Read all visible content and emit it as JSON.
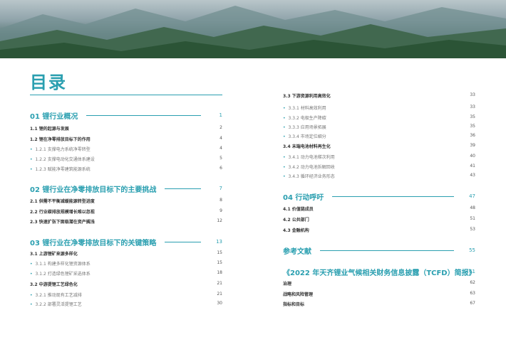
{
  "title": "目录",
  "left": [
    {
      "kind": "sec",
      "label": "01 锂行业概况",
      "page": "1"
    },
    {
      "kind": "sub",
      "label": "1.1 锂的起源与发展",
      "page": "2"
    },
    {
      "kind": "sub",
      "label": "1.2 锂在净零排放目标下的作用",
      "page": "4"
    },
    {
      "kind": "item",
      "label": "1.2.1 支撑电力系统净零转型",
      "page": "4"
    },
    {
      "kind": "item",
      "label": "1.2.2 支撑电动化交通体系建设",
      "page": "5"
    },
    {
      "kind": "item",
      "label": "1.2.3 赋能净零建筑能源系统",
      "page": "6"
    },
    {
      "kind": "sec",
      "label": "02 锂行业在净零排放目标下的主要挑战",
      "page": "7"
    },
    {
      "kind": "sub",
      "label": "2.1 供需不平衡减缓能源转型进度",
      "page": "8"
    },
    {
      "kind": "sub",
      "label": "2.2 行业碳排放规模增长难以忽视",
      "page": "9"
    },
    {
      "kind": "sub",
      "label": "2.3 快速扩张下面临潜在资产搁浅",
      "page": "12"
    },
    {
      "kind": "sec",
      "label": "03 锂行业在净零排放目标下的关键策略",
      "page": "13"
    },
    {
      "kind": "sub",
      "label": "3.1 上游锂矿来源多样化",
      "page": "15"
    },
    {
      "kind": "item",
      "label": "3.1.1 构建多样化锂资源体系",
      "page": "15"
    },
    {
      "kind": "item",
      "label": "3.1.2 打造绿色锂矿采选体系",
      "page": "18"
    },
    {
      "kind": "sub",
      "label": "3.2 中游提锂工艺绿色化",
      "page": "21"
    },
    {
      "kind": "item",
      "label": "3.2.1 推动现有工艺减排",
      "page": "21"
    },
    {
      "kind": "item",
      "label": "3.2.2 部署灵活提锂工艺",
      "page": "30"
    }
  ],
  "right": [
    {
      "kind": "sub",
      "label": "3.3 下游资源利用高效化",
      "page": "33"
    },
    {
      "kind": "item",
      "label": "3.3.1 材料高效利用",
      "page": "33"
    },
    {
      "kind": "item",
      "label": "3.3.2 电极生产降碳",
      "page": "35"
    },
    {
      "kind": "item",
      "label": "3.3.3 应用场景拓展",
      "page": "35"
    },
    {
      "kind": "item",
      "label": "3.3.4 市场定位細分",
      "page": "36"
    },
    {
      "kind": "sub",
      "label": "3.4 末端电池材料再生化",
      "page": "39"
    },
    {
      "kind": "item",
      "label": "3.4.1 动力电池梯次利用",
      "page": "40"
    },
    {
      "kind": "item",
      "label": "3.4.2 动力电池拆解回收",
      "page": "41"
    },
    {
      "kind": "item",
      "label": "3.4.3 循环经济业务形态",
      "page": "43"
    },
    {
      "kind": "sec",
      "label": "04 行动呼吁",
      "page": "47"
    },
    {
      "kind": "sub",
      "label": "4.1 价值链成员",
      "page": "48"
    },
    {
      "kind": "sub",
      "label": "4.2 公共部门",
      "page": "51"
    },
    {
      "kind": "sub",
      "label": "4.3 金融机构",
      "page": "53"
    },
    {
      "kind": "sec",
      "label": "参考文献",
      "page": "55"
    },
    {
      "kind": "sec",
      "label": "《2022 年天齐锂业气候相关财务信息披露（TCFD）简报》",
      "page": "61"
    },
    {
      "kind": "sub",
      "label": "治理",
      "page": "62"
    },
    {
      "kind": "sub",
      "label": "战略和风险管理",
      "page": "63"
    },
    {
      "kind": "sub",
      "label": "指标和目标",
      "page": "67"
    }
  ]
}
